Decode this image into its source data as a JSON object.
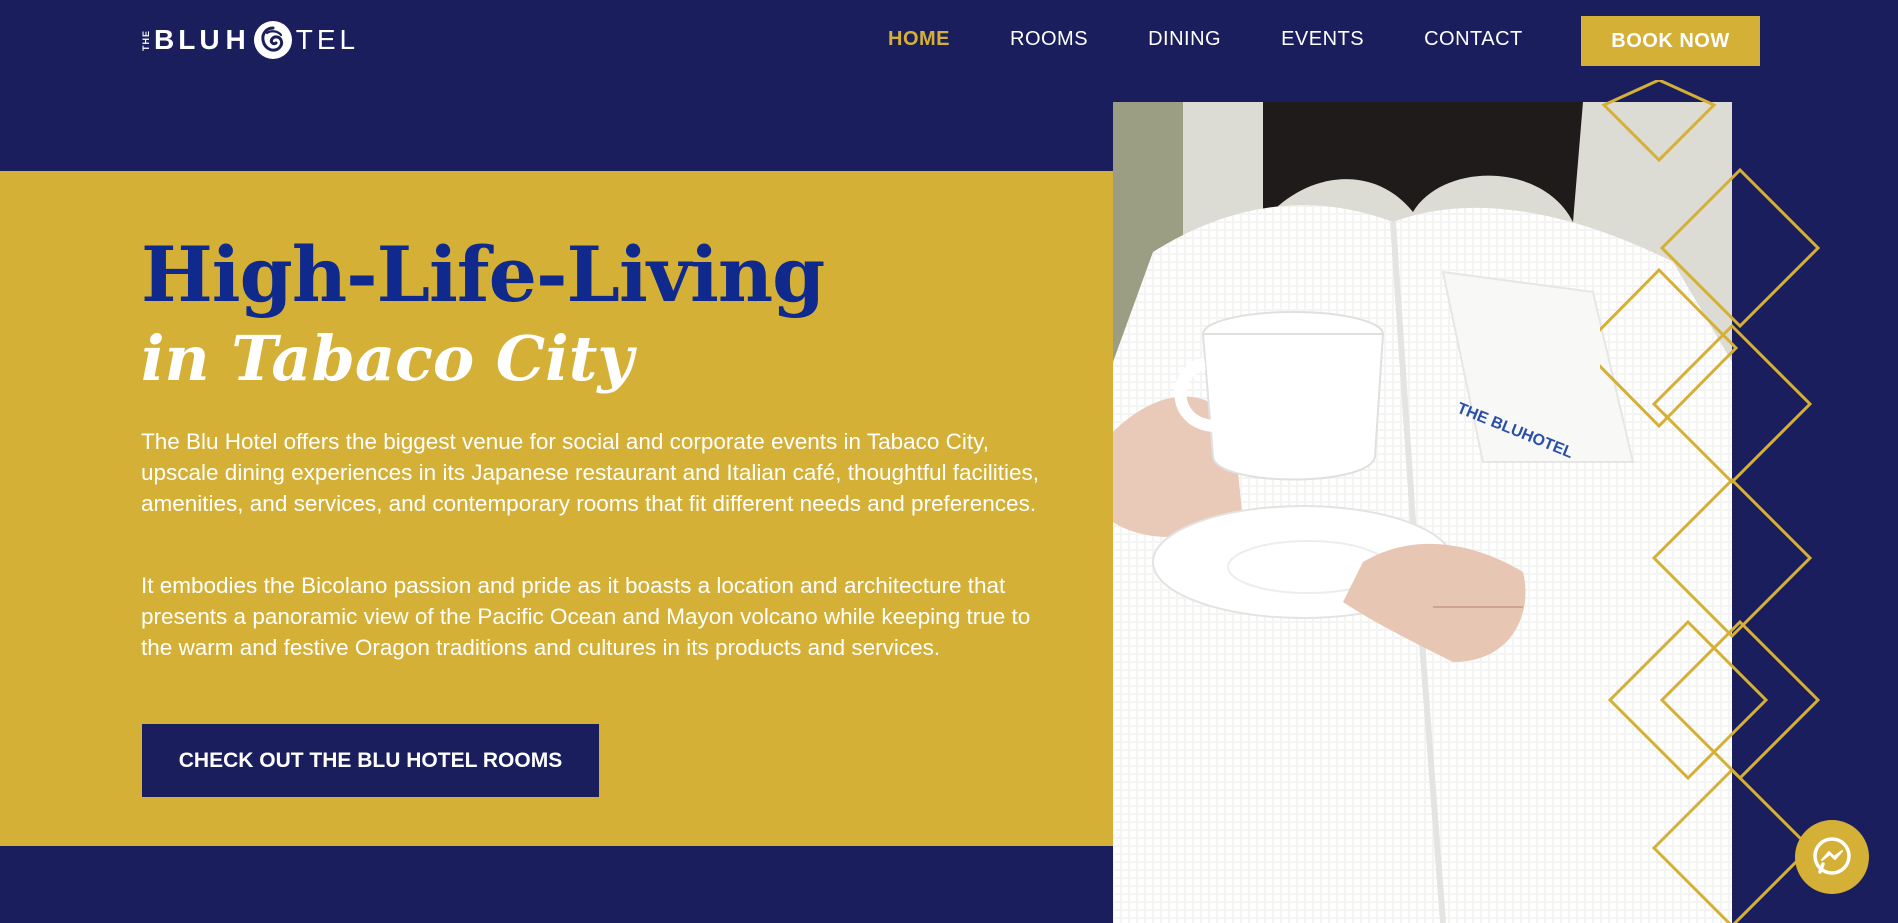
{
  "brand": {
    "the": "THE",
    "name_bold": "BLU",
    "name_mid": "H",
    "name_thin": "TEL"
  },
  "nav": {
    "items": [
      {
        "label": "HOME",
        "active": true
      },
      {
        "label": "ROOMS",
        "active": false
      },
      {
        "label": "DINING",
        "active": false
      },
      {
        "label": "EVENTS",
        "active": false
      },
      {
        "label": "CONTACT",
        "active": false
      }
    ],
    "book_now": "BOOK NOW"
  },
  "hero": {
    "title": "High-Life-Living",
    "subtitle": "in Tabaco City",
    "paragraphs": [
      "The Blu Hotel offers the biggest venue for social and corporate events in Tabaco City, upscale dining experiences in its Japanese restaurant and Italian café, thoughtful facilities, amenities, and services, and contemporary rooms that fit different needs and preferences.",
      "It embodies the Bicolano passion and pride as it boasts a location and architecture that presents a panoramic view of the Pacific Ocean and Mayon volcano while keeping true to the warm and festive Oragon traditions and cultures in its products and services."
    ],
    "cta": "CHECK OUT THE BLU HOTEL ROOMS"
  },
  "photo": {
    "robe_logo": "THE BLUHOTEL"
  },
  "colors": {
    "navy": "#1a1e5c",
    "gold": "#d4b037",
    "title_blue": "#0f2a8c",
    "white": "#ffffff"
  },
  "icons": {
    "messenger": "messenger-icon",
    "logo": "hotel-logo-mark-icon"
  }
}
